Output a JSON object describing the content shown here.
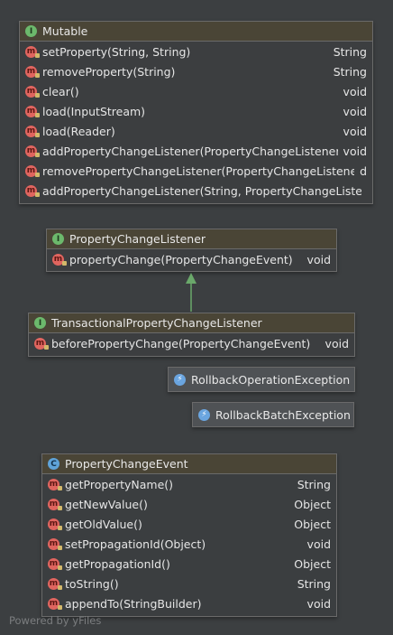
{
  "colors": {
    "background": "#3c3f41",
    "header": "#4a4536",
    "method_icon": "#e0655f",
    "interface_icon": "#6cb96c",
    "class_icon": "#5fa3d8",
    "arrow": "#6aa86a"
  },
  "mutable": {
    "badge": "I",
    "title": "Mutable",
    "methods": [
      {
        "name": "setProperty(String, String)",
        "type": "String"
      },
      {
        "name": "removeProperty(String)",
        "type": "String"
      },
      {
        "name": "clear()",
        "type": "void"
      },
      {
        "name": "load(InputStream)",
        "type": "void"
      },
      {
        "name": "load(Reader)",
        "type": "void"
      },
      {
        "name": "addPropertyChangeListener(PropertyChangeListener)",
        "type": "void"
      },
      {
        "name": "removePropertyChangeListener(PropertyChangeListener)",
        "type": "d"
      },
      {
        "name": "addPropertyChangeListener(String, PropertyChangeListener",
        "type": ""
      }
    ]
  },
  "pcl": {
    "badge": "I",
    "title": "PropertyChangeListener",
    "methods": [
      {
        "name": "propertyChange(PropertyChangeEvent)",
        "type": "void"
      }
    ]
  },
  "tpcl": {
    "badge": "I",
    "title": "TransactionalPropertyChangeListener",
    "methods": [
      {
        "name": "beforePropertyChange(PropertyChangeEvent)",
        "type": "void"
      }
    ]
  },
  "roe": {
    "title": "RollbackOperationException"
  },
  "rbe": {
    "title": "RollbackBatchException"
  },
  "pce": {
    "badge": "C",
    "title": "PropertyChangeEvent",
    "methods": [
      {
        "name": "getPropertyName()",
        "type": "String"
      },
      {
        "name": "getNewValue()",
        "type": "Object"
      },
      {
        "name": "getOldValue()",
        "type": "Object"
      },
      {
        "name": "setPropagationId(Object)",
        "type": "void"
      },
      {
        "name": "getPropagationId()",
        "type": "Object"
      },
      {
        "name": "toString()",
        "type": "String"
      },
      {
        "name": "appendTo(StringBuilder)",
        "type": "void"
      }
    ]
  },
  "footer": "Powered by yFiles"
}
